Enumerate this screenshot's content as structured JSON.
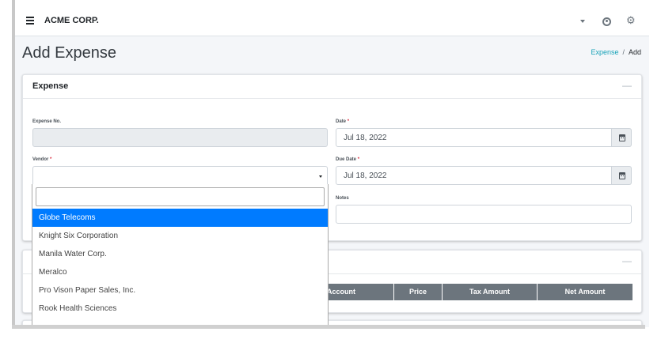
{
  "navbar": {
    "brand": "ACME CORP.",
    "icons": [
      "menu-icon",
      "caret-down-icon",
      "user-icon",
      "cogs-icon"
    ]
  },
  "header": {
    "title": "Add Expense",
    "breadcrumb": {
      "link": "Expense",
      "separator": "/",
      "current": "Add"
    }
  },
  "expense_card": {
    "title": "Expense",
    "collapse": "—",
    "fields": {
      "expense_no": {
        "label": "Expense No.",
        "value": ""
      },
      "date": {
        "label": "Date",
        "required": "*",
        "value": "Jul 18, 2022"
      },
      "vendor": {
        "label": "Vendor",
        "required": "*",
        "value": ""
      },
      "due_date": {
        "label": "Due Date",
        "required": "*",
        "value": "Jul 18, 2022"
      },
      "notes": {
        "label": "Notes",
        "value": ""
      }
    }
  },
  "vendor_dropdown": {
    "search_value": "",
    "options": [
      "Globe Telecoms",
      "Knight Six Corporation",
      "Manila Water Corp.",
      "Meralco",
      "Pro Vison Paper Sales, Inc.",
      "Rook Health Sciences"
    ],
    "selected_index": 0
  },
  "items_card": {
    "collapse": "—",
    "columns": [
      "Account",
      "Price",
      "Tax Amount",
      "Net Amount"
    ]
  },
  "colors": {
    "accent": "#007bff",
    "link": "#17a2b8",
    "required": "#dc3545",
    "table_header": "#6c757d"
  }
}
